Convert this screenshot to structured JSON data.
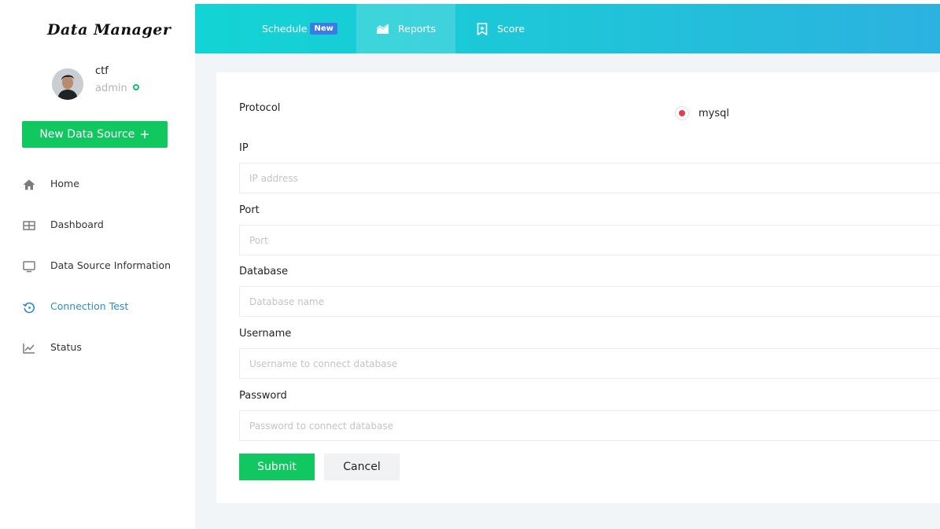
{
  "app": {
    "logo_main": "Data Manager"
  },
  "user": {
    "name": "ctf",
    "role": "admin",
    "status": "online"
  },
  "sidebar": {
    "new_button_label": "New Data Source",
    "new_button_icon": "plus-icon",
    "items": [
      {
        "label": "Home",
        "icon": "home-icon",
        "active": false
      },
      {
        "label": "Dashboard",
        "icon": "grid-icon",
        "active": false
      },
      {
        "label": "Data Source Information",
        "icon": "monitor-icon",
        "active": false
      },
      {
        "label": "Connection Test",
        "icon": "history-icon",
        "active": true
      },
      {
        "label": "Status",
        "icon": "line-chart-icon",
        "active": false
      }
    ]
  },
  "topbar": {
    "tabs": [
      {
        "label": "Schedule",
        "badge": "New"
      },
      {
        "label": "Reports",
        "icon": "area-chart-icon",
        "active": true
      },
      {
        "label": "Score",
        "icon": "bookmark-star-icon"
      }
    ]
  },
  "form": {
    "protocol": {
      "label": "Protocol",
      "options": [
        {
          "label": "mysql",
          "selected": true
        }
      ]
    },
    "ip": {
      "label": "IP",
      "placeholder": "IP address",
      "value": ""
    },
    "port": {
      "label": "Port",
      "placeholder": "Port",
      "value": ""
    },
    "database": {
      "label": "Database",
      "placeholder": "Database name",
      "value": ""
    },
    "username": {
      "label": "Username",
      "placeholder": "Username to connect database",
      "value": ""
    },
    "password": {
      "label": "Password",
      "placeholder": "Password to connect database",
      "value": ""
    },
    "submit_label": "Submit",
    "cancel_label": "Cancel"
  },
  "colors": {
    "accent_green": "#10c760",
    "active_blue": "#2e8bd4",
    "topbar_start": "#12d4d4",
    "topbar_end": "#2cb2e0",
    "badge_blue": "#3b7be6",
    "radio_red": "#e43d4c",
    "online_green": "#12c365"
  }
}
